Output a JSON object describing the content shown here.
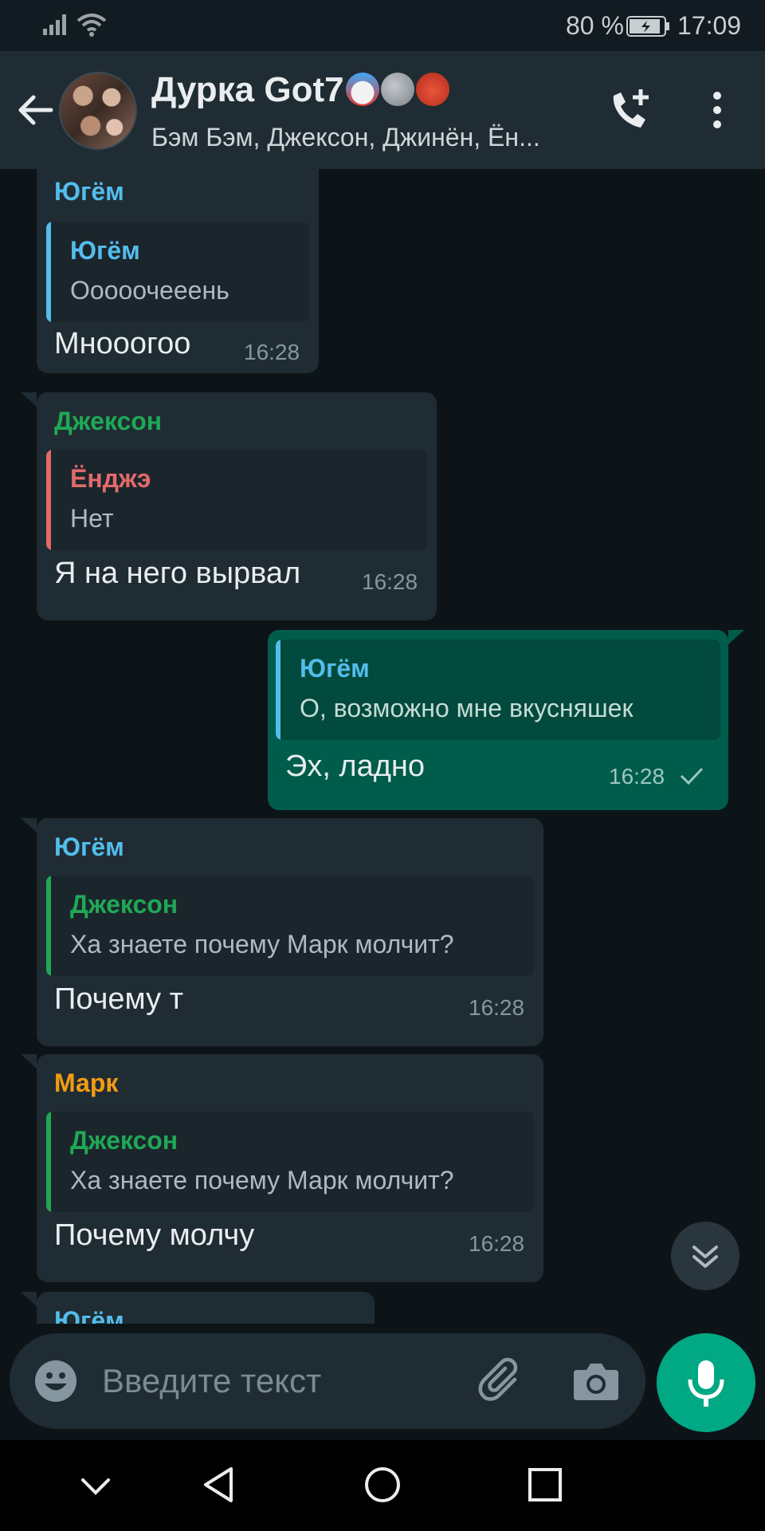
{
  "status_bar": {
    "battery": "80 %",
    "time": "17:09"
  },
  "header": {
    "title": "Дурка Got7",
    "subtitle": "Бэм Бэм, Джексон, Джинён, Ён..."
  },
  "colors": {
    "accent": "#00a884",
    "outgoing_bubble": "#005c4b",
    "incoming_bubble": "#202c33",
    "name_yugyeom": "#53bdeb",
    "name_jackson": "#1fa855",
    "name_youngjae": "#e26a6a",
    "name_mark": "#f39c12"
  },
  "messages": [
    {
      "sender": "Югём",
      "quote_name": "Югём",
      "quote_text": "Ооооочееень",
      "text": "Мнооогоо",
      "time": "16:28"
    },
    {
      "sender": "Джексон",
      "quote_name": "Ёнджэ",
      "quote_text": "Нет",
      "text": "Я на него вырвал",
      "time": "16:28"
    },
    {
      "quote_name": "Югём",
      "quote_text": "О,  возможно мне вкусняшек",
      "text": "Эх, ладно",
      "time": "16:28"
    },
    {
      "sender": "Югём",
      "quote_name": "Джексон",
      "quote_text": "Ха знаете почему Марк молчит?",
      "text": "Почему т",
      "time": "16:28"
    },
    {
      "sender": "Марк",
      "quote_name": "Джексон",
      "quote_text": "Ха знаете почему Марк молчит?",
      "text": "Почему молчу",
      "time": "16:28"
    },
    {
      "sender": "Югём"
    }
  ],
  "input": {
    "placeholder": "Введите текст"
  }
}
